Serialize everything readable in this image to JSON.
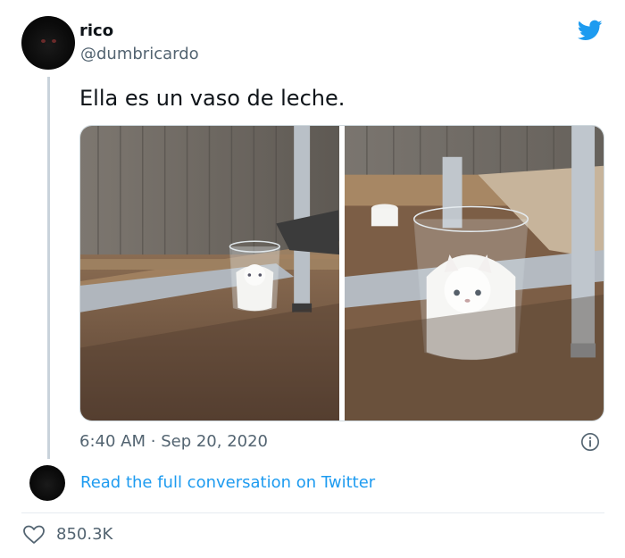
{
  "user": {
    "name": "rico",
    "handle": "@dumbricardo"
  },
  "tweet": {
    "text": "Ella es un vaso de leche.",
    "time": "6:40 AM",
    "separator": "·",
    "date": "Sep 20, 2020"
  },
  "read_link": "Read the full conversation on Twitter",
  "likes": "850.3K",
  "colors": {
    "brand": "#1d9bf0",
    "text": "#0f1419",
    "muted": "#536471"
  },
  "icons": [
    "twitter-bird-icon",
    "info-icon",
    "heart-icon"
  ]
}
